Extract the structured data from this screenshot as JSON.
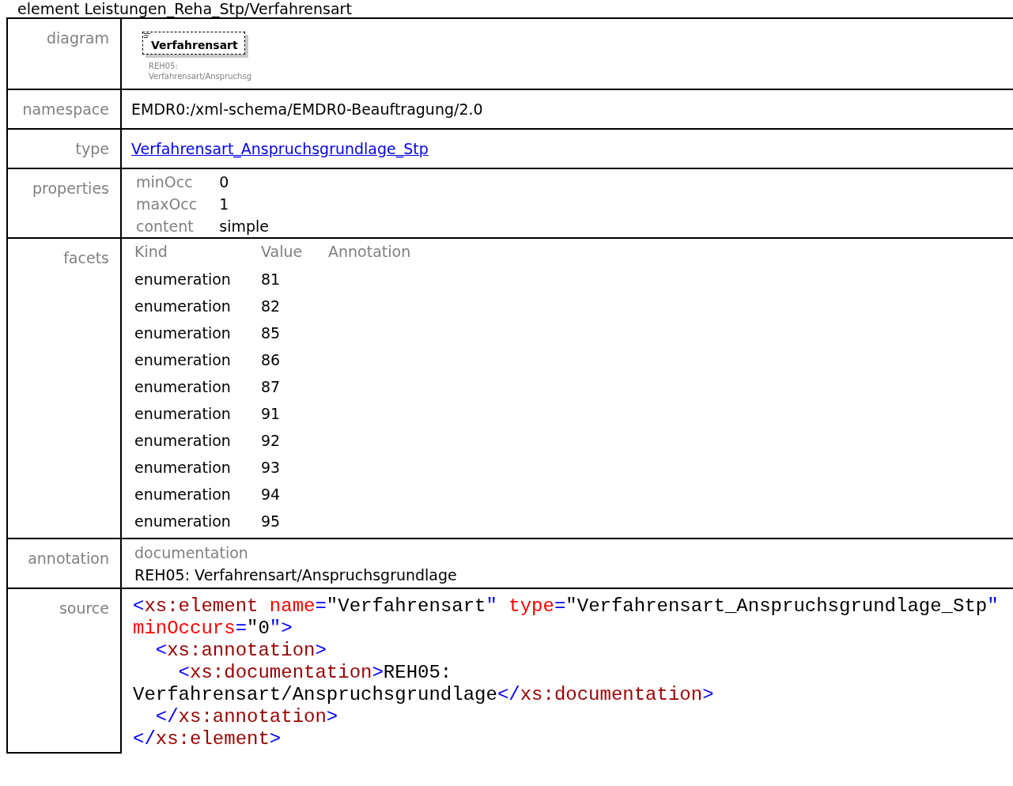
{
  "heading": "element Leistungen_Reha_Stp/Verfahrensart",
  "diagram": {
    "label": "diagram",
    "element": "Verfahrensart",
    "doc_lines": [
      "REH05:",
      "Verfahrensart/Anspruchsg"
    ]
  },
  "namespace": {
    "label": "namespace",
    "value": "EMDR0:/xml-schema/EMDR0-Beauftragung/2.0"
  },
  "type": {
    "label": "type",
    "link": "Verfahrensart_Anspruchsgrundlage_Stp"
  },
  "properties": {
    "label": "properties",
    "rows": [
      {
        "name": "minOcc",
        "value": "0"
      },
      {
        "name": "maxOcc",
        "value": "1"
      },
      {
        "name": "content",
        "value": "simple"
      }
    ]
  },
  "facets": {
    "label": "facets",
    "columns": [
      "Kind",
      "Value",
      "Annotation"
    ],
    "rows": [
      {
        "kind": "enumeration",
        "value": "81"
      },
      {
        "kind": "enumeration",
        "value": "82"
      },
      {
        "kind": "enumeration",
        "value": "85"
      },
      {
        "kind": "enumeration",
        "value": "86"
      },
      {
        "kind": "enumeration",
        "value": "87"
      },
      {
        "kind": "enumeration",
        "value": "91"
      },
      {
        "kind": "enumeration",
        "value": "92"
      },
      {
        "kind": "enumeration",
        "value": "93"
      },
      {
        "kind": "enumeration",
        "value": "94"
      },
      {
        "kind": "enumeration",
        "value": "95"
      }
    ]
  },
  "annotation": {
    "label": "annotation",
    "heading": "documentation",
    "text": "REH05: Verfahrensart/Anspruchsgrundlage"
  },
  "source": {
    "label": "source",
    "lines": [
      [
        {
          "kind": "punct",
          "text": "<"
        },
        {
          "kind": "tag",
          "text": "xs:element"
        },
        {
          "kind": "attr",
          "text": " name"
        },
        {
          "kind": "punct",
          "text": "="
        },
        {
          "kind": "text",
          "text": "\"Verfahrensart"
        },
        {
          "kind": "punct",
          "text": "\""
        },
        {
          "kind": "attr",
          "text": " type"
        },
        {
          "kind": "punct",
          "text": "="
        },
        {
          "kind": "text",
          "text": "\"Verfahrensart_Anspruchsgrundlage_Stp"
        },
        {
          "kind": "punct",
          "text": "\""
        }
      ],
      [
        {
          "kind": "attr",
          "text": "minOccurs"
        },
        {
          "kind": "punct",
          "text": "="
        },
        {
          "kind": "text",
          "text": "\"0"
        },
        {
          "kind": "punct",
          "text": "\">"
        }
      ],
      [
        {
          "kind": "punct",
          "text": "  <"
        },
        {
          "kind": "tag",
          "text": "xs:annotation"
        },
        {
          "kind": "punct",
          "text": ">"
        }
      ],
      [
        {
          "kind": "punct",
          "text": "    <"
        },
        {
          "kind": "tag",
          "text": "xs:documentation"
        },
        {
          "kind": "punct",
          "text": ">"
        },
        {
          "kind": "text",
          "text": "REH05:"
        }
      ],
      [
        {
          "kind": "text",
          "text": "Verfahrensart/Anspruchsgrundlage"
        },
        {
          "kind": "punct",
          "text": "</"
        },
        {
          "kind": "tag",
          "text": "xs:documentation"
        },
        {
          "kind": "punct",
          "text": ">"
        }
      ],
      [
        {
          "kind": "punct",
          "text": "  </"
        },
        {
          "kind": "tag",
          "text": "xs:annotation"
        },
        {
          "kind": "punct",
          "text": ">"
        }
      ],
      [
        {
          "kind": "punct",
          "text": "</"
        },
        {
          "kind": "tag",
          "text": "xs:element"
        },
        {
          "kind": "punct",
          "text": ">"
        }
      ]
    ]
  }
}
